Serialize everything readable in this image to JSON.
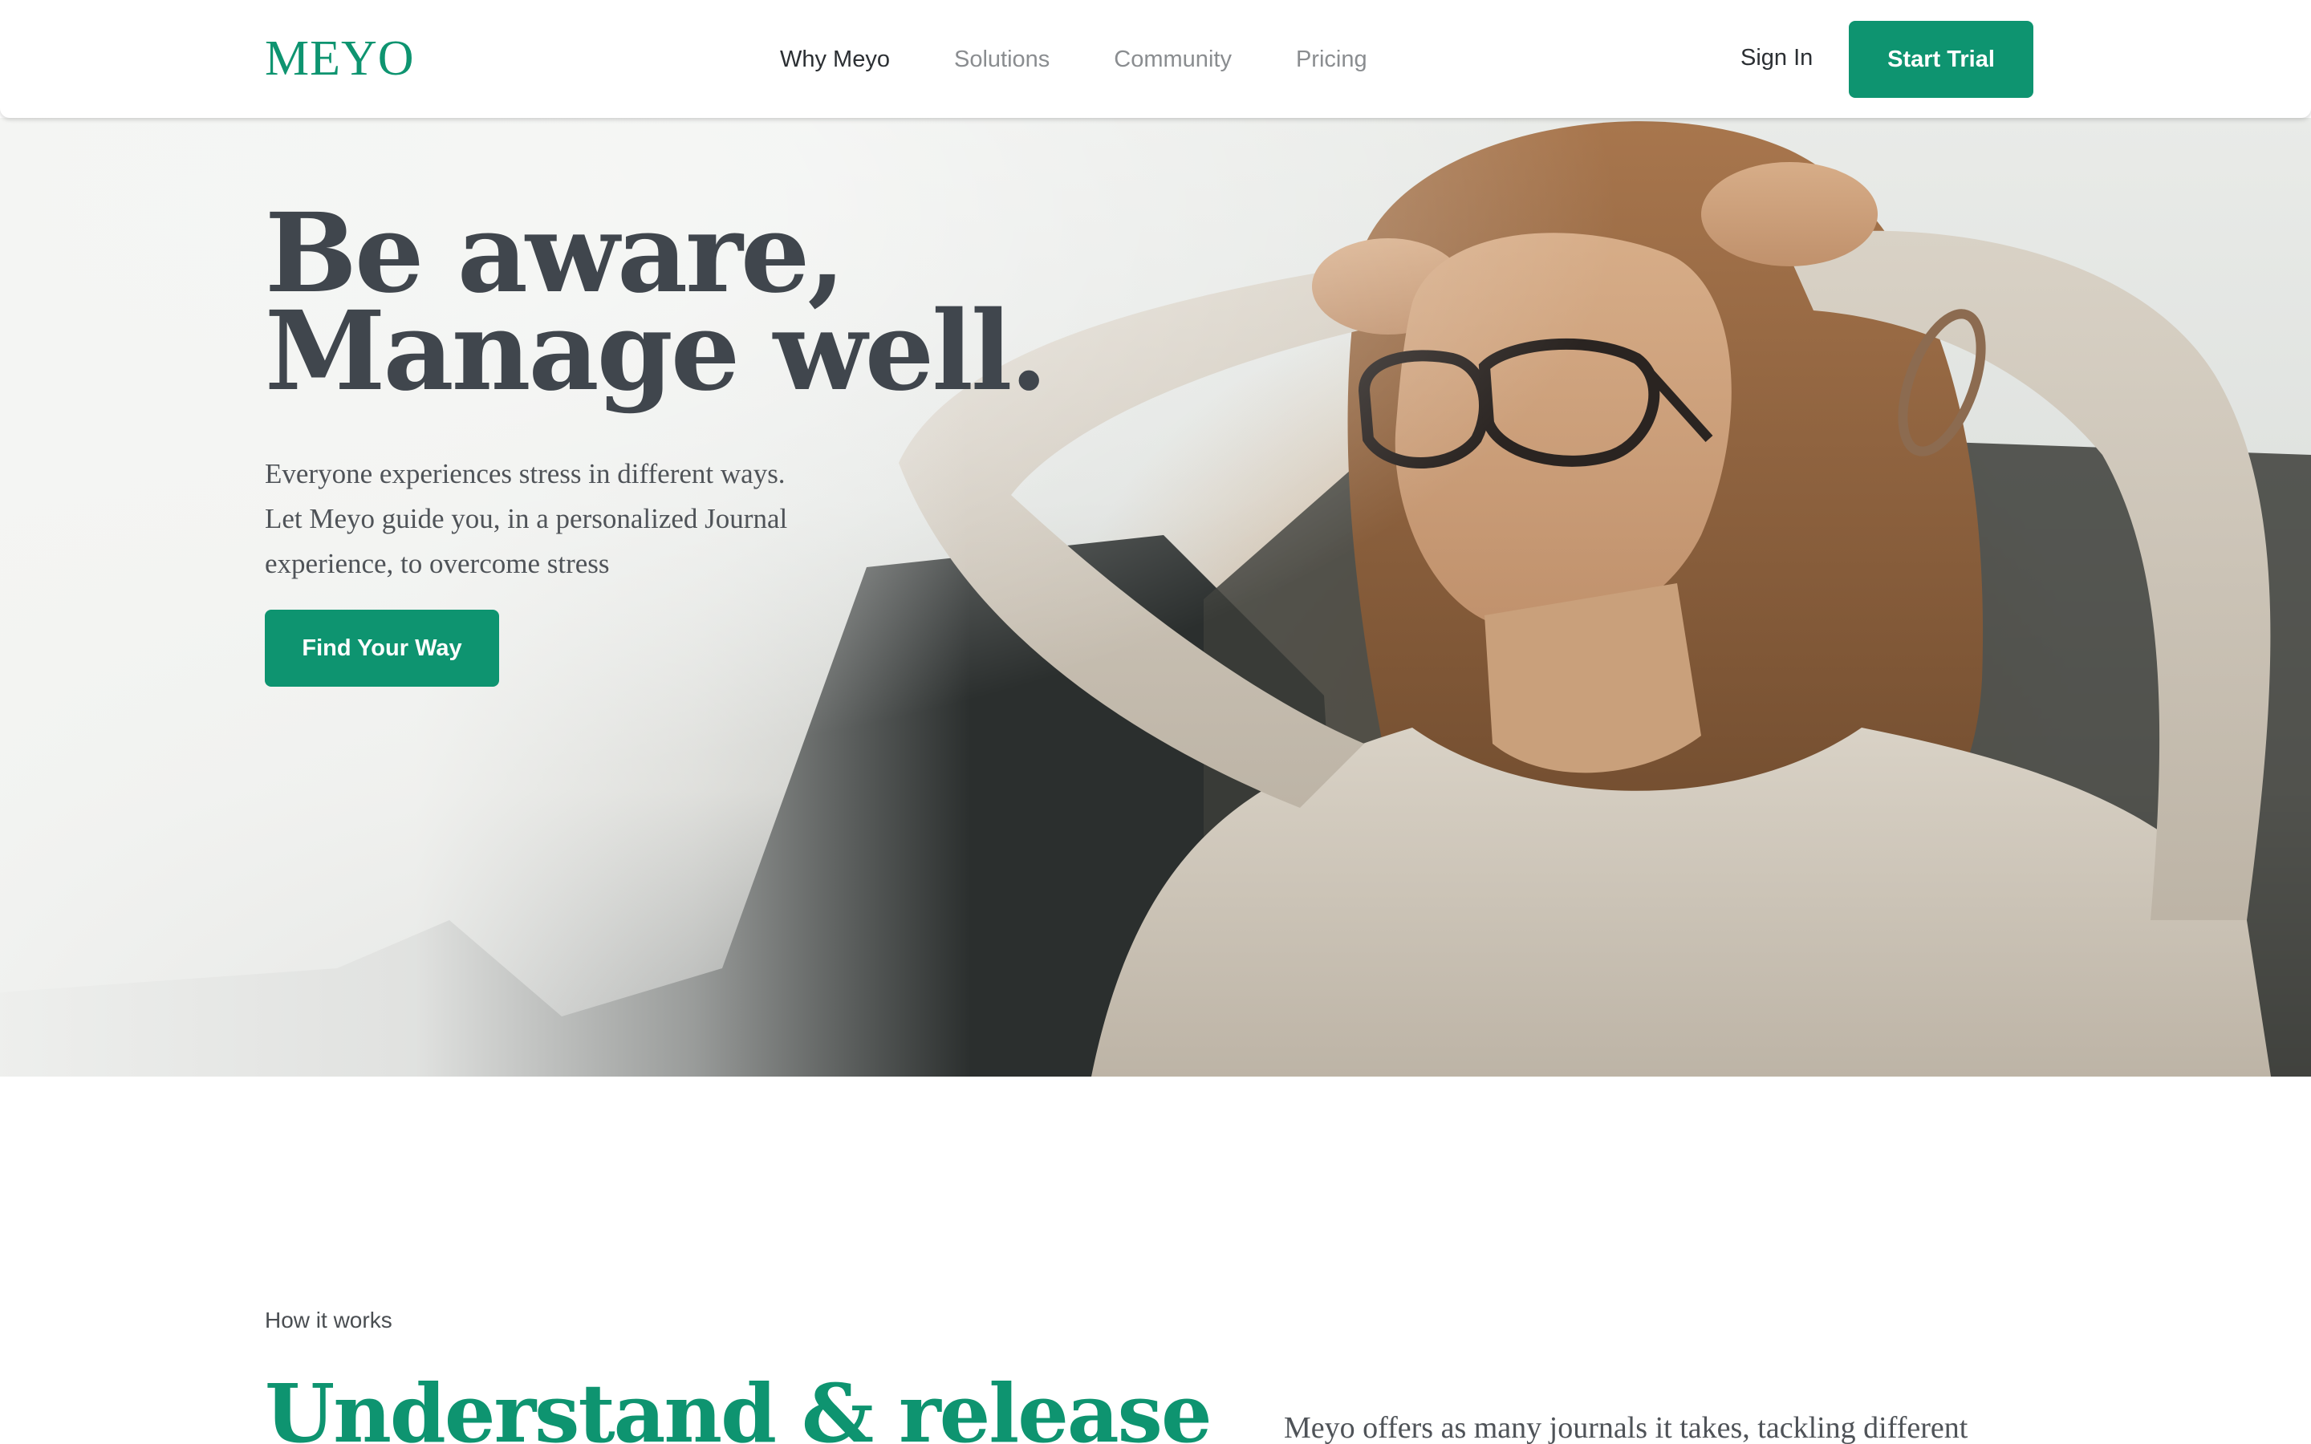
{
  "header": {
    "logo": "MEYO",
    "nav": [
      {
        "label": "Why Meyo",
        "active": true
      },
      {
        "label": "Solutions",
        "active": false
      },
      {
        "label": "Community",
        "active": false
      },
      {
        "label": "Pricing",
        "active": false
      }
    ],
    "sign_in": "Sign In",
    "cta": "Start Trial"
  },
  "hero": {
    "headline_line1": "Be aware,",
    "headline_line2": "Manage well.",
    "text_line1": "Everyone experiences stress in different ways.",
    "text_line2": "Let Meyo guide you, in a personalized Journal",
    "text_line3": "experience, to overcome stress",
    "cta": "Find Your Way",
    "image": "woman-relaxing-sunlight-photo"
  },
  "how_it_works": {
    "label": "How it works",
    "title": "Understand & release",
    "text": "Meyo offers as many journals it takes, tackling different"
  },
  "colors": {
    "brand": "#0e9470",
    "heading": "#40464d",
    "body_text": "#4f5358"
  }
}
